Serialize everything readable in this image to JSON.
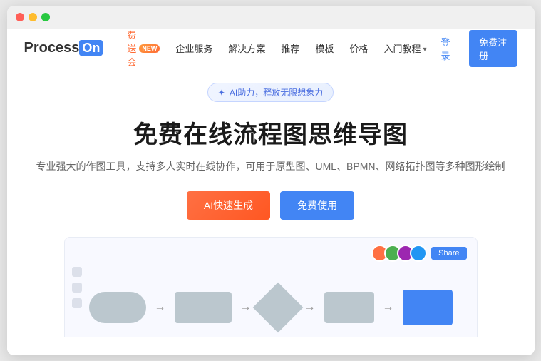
{
  "browser": {
    "dots": [
      "red",
      "yellow",
      "green"
    ]
  },
  "navbar": {
    "logo": "Process",
    "logo_suffix": "On",
    "nav_items": [
      {
        "label": "免费送会员",
        "badge": "NEW",
        "is_vip": true
      },
      {
        "label": "企业服务",
        "is_vip": false
      },
      {
        "label": "解决方案",
        "is_vip": false
      },
      {
        "label": "推荐",
        "is_vip": false
      },
      {
        "label": "模板",
        "is_vip": false
      },
      {
        "label": "价格",
        "is_vip": false
      },
      {
        "label": "入门教程",
        "has_arrow": true,
        "is_vip": false
      }
    ],
    "login_label": "登录",
    "register_label": "免费注册"
  },
  "hero": {
    "ai_badge": "✦ AI助力，释放无限想象力",
    "title": "免费在线流程图思维导图",
    "subtitle": "专业强大的作图工具，支持多人实时在线协作，可用于原型图、UML、BPMN、网络拓扑图等多种图形绘制",
    "btn_ai": "AI快速生成",
    "btn_free": "免费使用",
    "share_label": "Share"
  }
}
